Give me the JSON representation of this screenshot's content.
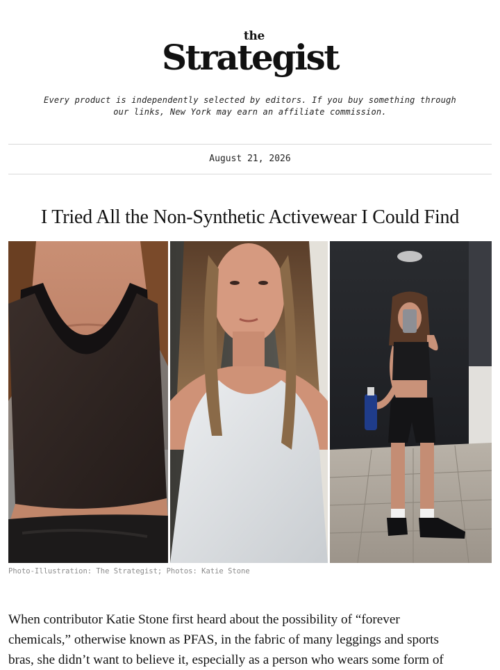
{
  "brand": {
    "logo_prefix": "the",
    "logo_name": "Strategist"
  },
  "disclaimer": {
    "line1": "Every product is independently selected by editors. If you buy something through",
    "line2": "our links, New York may earn an affiliate commission."
  },
  "article": {
    "date": "August 21, 2026",
    "headline": "I Tried All the Non-Synthetic Activewear I Could Find",
    "photo_credit": "Photo-Illustration: The Strategist; Photos: Katie Stone",
    "body_lines": [
      "When contributor Katie Stone first heard about the possibility of “forever",
      "chemicals,” otherwise known as PFAS, in the fabric of many leggings and sports",
      "bras, she didn’t want to believe it, especially as a person who wears some form of"
    ]
  },
  "colors": {
    "text": "#111111",
    "rule": "#d9d9d9",
    "credit": "#8a8a8a"
  }
}
